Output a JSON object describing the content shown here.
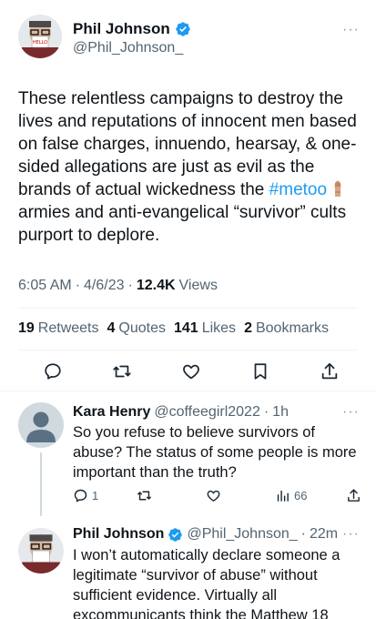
{
  "main_tweet": {
    "display_name": "Phil Johnson",
    "handle": "@Phil_Johnson_",
    "more": "···",
    "text_parts": {
      "line_a": "These relentless campaigns to destroy the lives and reputations of innocent men based on false charges, innuendo, hearsay, & one-sided allegations are just as evil as the brands of actual wickedness the ",
      "hashtag": "#metoo",
      "line_b": " armies and anti-evangelical “survivor” cults purport to deplore."
    },
    "time": "6:05 AM",
    "date": "4/6/23",
    "views_count": "12.4K",
    "views_label": "Views",
    "sep": "·"
  },
  "stats": {
    "retweets_count": "19",
    "retweets_label": "Retweets",
    "quotes_count": "4",
    "quotes_label": "Quotes",
    "likes_count": "141",
    "likes_label": "Likes",
    "bookmarks_count": "2",
    "bookmarks_label": "Bookmarks"
  },
  "replies": [
    {
      "display_name": "Kara Henry",
      "handle": "@coffeegirl2022",
      "time": "1h",
      "sep": "·",
      "more": "···",
      "text": "So you refuse to believe survivors of abuse? The status of some people is more important than the truth?",
      "reply_count": "1",
      "views_count": "66"
    },
    {
      "display_name": "Phil Johnson",
      "handle": "@Phil_Johnson_",
      "time": "22m",
      "sep": "·",
      "more": "···",
      "text": "I won’t automatically declare someone a legitimate “survivor of abuse” without sufficient evidence. Virtually all excommunicants think the Matthew 18"
    }
  ],
  "colors": {
    "accent": "#1d9bf0",
    "text": "#0f1419",
    "muted": "#536471",
    "divider": "#eff3f4"
  }
}
